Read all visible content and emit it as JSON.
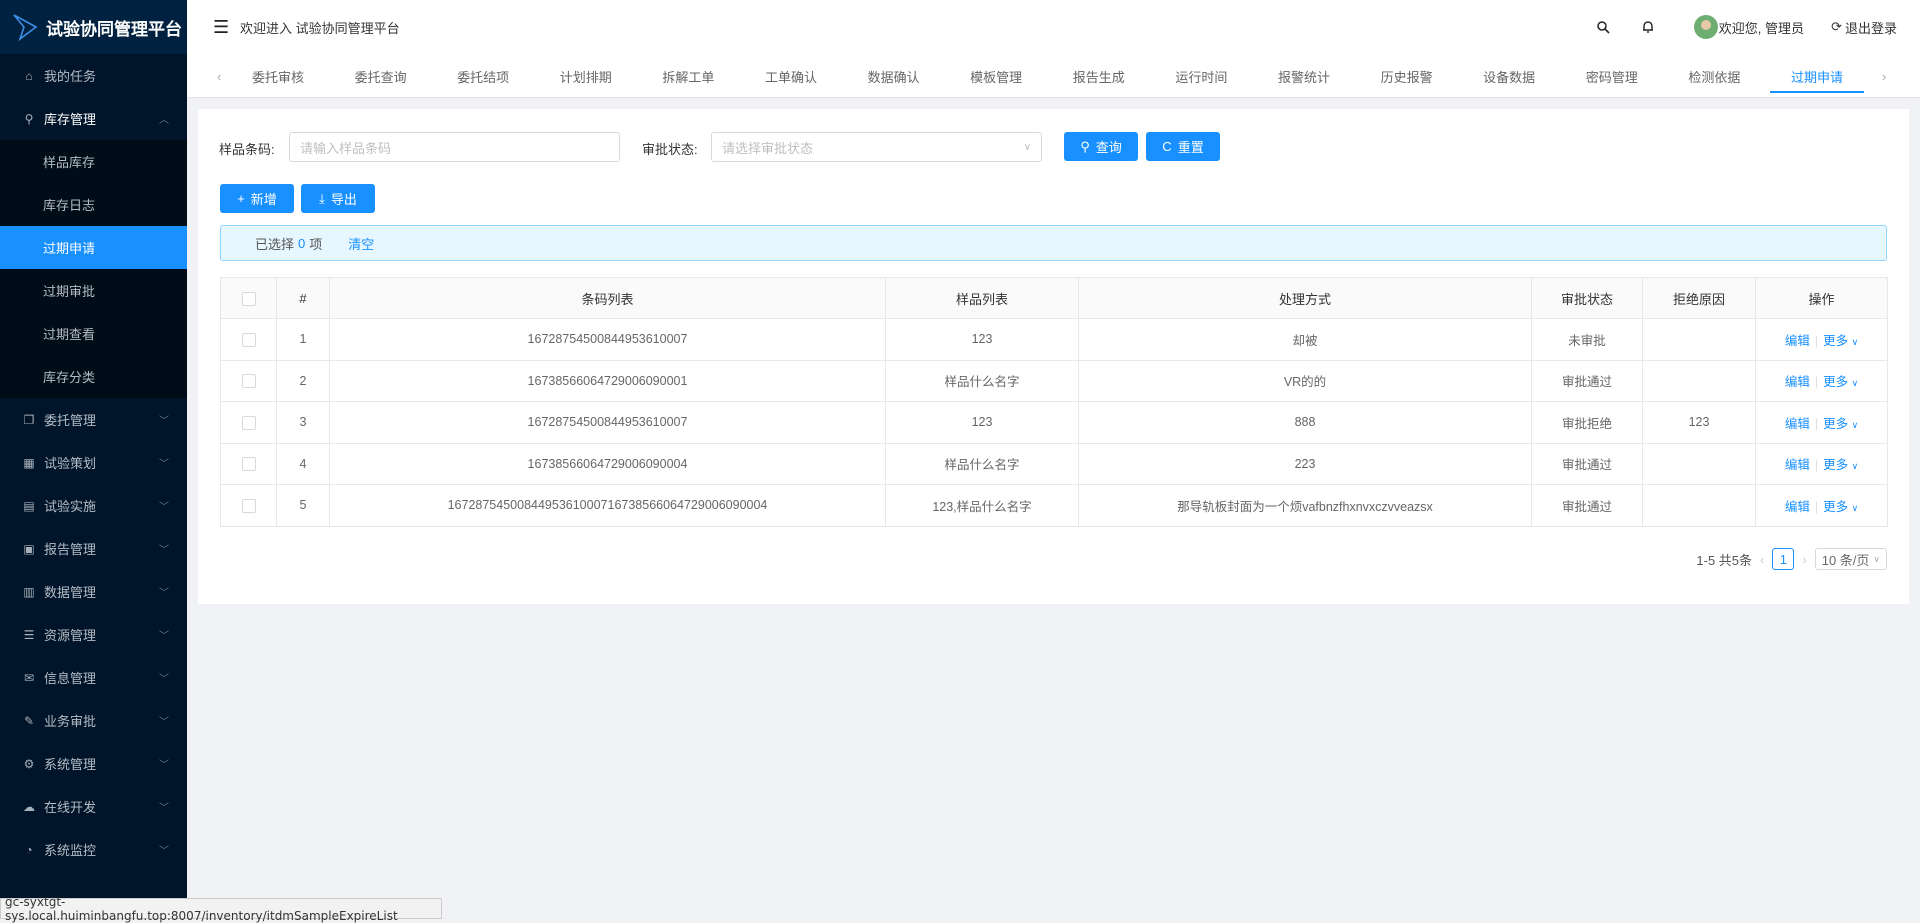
{
  "app": {
    "title": "试验协同管理平台",
    "welcome": "欢迎进入 试验协同管理平台"
  },
  "header": {
    "greeting": "欢迎您,  管理员",
    "logout": "退出登录"
  },
  "sidebar": {
    "items": [
      {
        "label": "我的任务",
        "icon": "home-icon"
      },
      {
        "label": "库存管理",
        "icon": "wrench-icon",
        "open": true,
        "children": [
          {
            "label": "样品库存"
          },
          {
            "label": "库存日志"
          },
          {
            "label": "过期申请",
            "active": true
          },
          {
            "label": "过期审批"
          },
          {
            "label": "过期查看"
          },
          {
            "label": "库存分类"
          }
        ]
      },
      {
        "label": "委托管理",
        "icon": "copy-icon"
      },
      {
        "label": "试验策划",
        "icon": "calendar-icon"
      },
      {
        "label": "试验实施",
        "icon": "grid-icon"
      },
      {
        "label": "报告管理",
        "icon": "report-icon"
      },
      {
        "label": "数据管理",
        "icon": "bar-chart-icon"
      },
      {
        "label": "资源管理",
        "icon": "list-icon"
      },
      {
        "label": "信息管理",
        "icon": "mail-icon"
      },
      {
        "label": "业务审批",
        "icon": "pen-icon"
      },
      {
        "label": "系统管理",
        "icon": "gear-icon"
      },
      {
        "label": "在线开发",
        "icon": "cloud-icon"
      },
      {
        "label": "系统监控",
        "icon": "dashboard-icon"
      }
    ]
  },
  "tabs": [
    "委托审核",
    "委托查询",
    "委托结项",
    "计划排期",
    "拆解工单",
    "工单确认",
    "数据确认",
    "模板管理",
    "报告生成",
    "运行时间",
    "报警统计",
    "历史报警",
    "设备数据",
    "密码管理",
    "检测依据",
    "过期申请"
  ],
  "active_tab": "过期申请",
  "search": {
    "barcode_label": "样品条码:",
    "barcode_placeholder": "请输入样品条码",
    "status_label": "审批状态:",
    "status_placeholder": "请选择审批状态",
    "query": "查询",
    "reset": "重置"
  },
  "toolbar": {
    "add": "新增",
    "export": "导出"
  },
  "alert": {
    "prefix": "已选择",
    "count": "0",
    "suffix": "项",
    "clear": "清空"
  },
  "table": {
    "headers": [
      "#",
      "条码列表",
      "样品列表",
      "处理方式",
      "审批状态",
      "拒绝原因",
      "操作"
    ],
    "rows": [
      {
        "no": "1",
        "barcode": "16728754500844953610007",
        "sample": "123",
        "method": "却被",
        "status": "未审批",
        "reason": ""
      },
      {
        "no": "2",
        "barcode": "16738566064729006090001",
        "sample": "样品什么名字",
        "method": "VR的的",
        "status": "审批通过",
        "reason": ""
      },
      {
        "no": "3",
        "barcode": "16728754500844953610007",
        "sample": "123",
        "method": "888",
        "status": "审批拒绝",
        "reason": "123"
      },
      {
        "no": "4",
        "barcode": "16738566064729006090004",
        "sample": "样品什么名字",
        "method": "223",
        "status": "审批通过",
        "reason": ""
      },
      {
        "no": "5",
        "barcode": "1672875450084495361000716738566064729006090004",
        "sample": "123,样品什么名字",
        "method": "那导轨板封面为一个烦vafbnzfhxnvxczvveazsx",
        "status": "审批通过",
        "reason": ""
      }
    ],
    "edit": "编辑",
    "more": "更多"
  },
  "pagination": {
    "total": "1-5 共5条",
    "page": "1",
    "page_size": "10 条/页"
  },
  "status_url": "gc-syxtgt-sys.local.huiminbangfu.top:8007/inventory/itdmSampleExpireList",
  "colors": {
    "primary": "#1890ff",
    "sidebar": "#001529"
  }
}
